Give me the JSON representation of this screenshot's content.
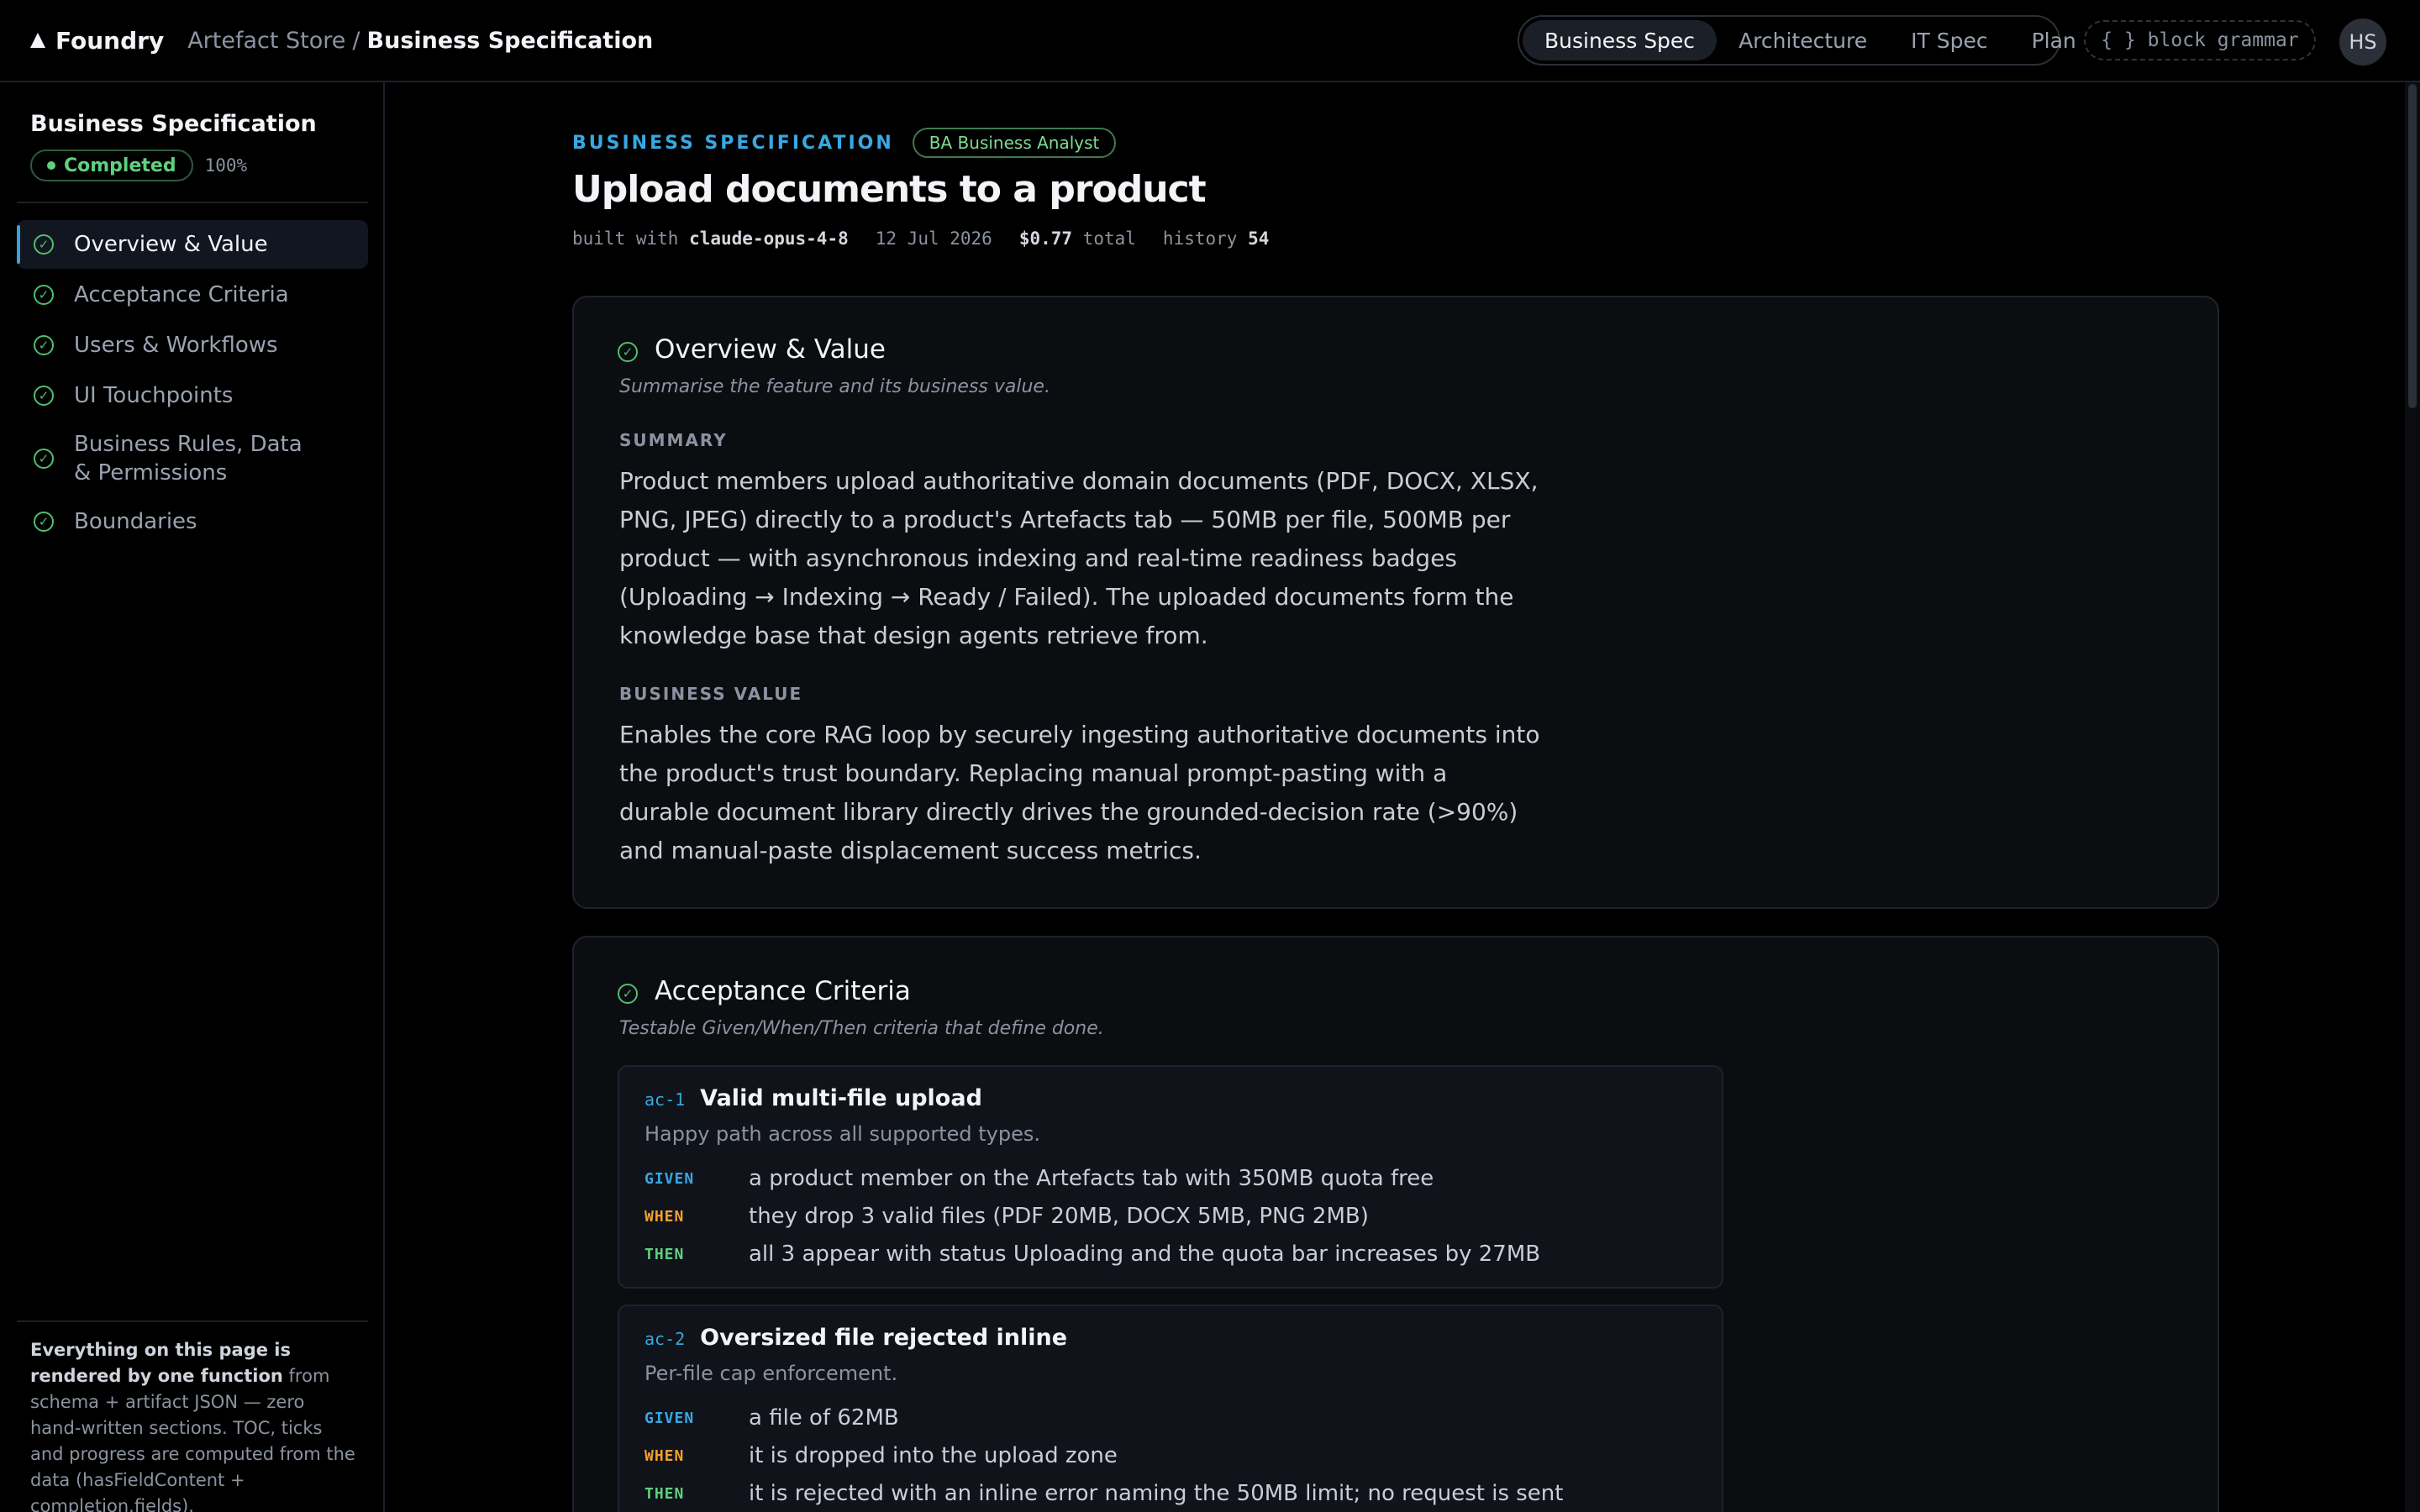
{
  "app": {
    "brand": "Foundry"
  },
  "breadcrumb": {
    "parent": "Artefact Store",
    "separator": "/",
    "current": "Business Specification"
  },
  "tabs": [
    {
      "label": "Business Spec",
      "active": true
    },
    {
      "label": "Architecture",
      "active": false
    },
    {
      "label": "IT Spec",
      "active": false
    },
    {
      "label": "Plan",
      "active": false
    }
  ],
  "header": {
    "grammar_label": "{ } block grammar",
    "avatar_initials": "HS"
  },
  "sidebar": {
    "title": "Business Specification",
    "status_label": "Completed",
    "progress": "100%",
    "items": [
      {
        "label": "Overview & Value",
        "active": true
      },
      {
        "label": "Acceptance Criteria",
        "active": false
      },
      {
        "label": "Users & Workflows",
        "active": false
      },
      {
        "label": "UI Touchpoints",
        "active": false
      },
      {
        "label": "Business Rules, Data & Permissions",
        "active": false
      },
      {
        "label": "Boundaries",
        "active": false
      }
    ],
    "footer_bold": "Everything on this page is rendered by one function",
    "footer_text": "from schema + artifact JSON — zero hand-written sections. TOC, ticks and progress are computed from the data (hasFieldContent + completion.fields)."
  },
  "page": {
    "eyebrow": "BUSINESS SPECIFICATION",
    "role_badge": "BA Business Analyst",
    "title": "Upload documents to a product",
    "meta": {
      "built_with_label": "built with",
      "model": "claude-opus-4-8",
      "date": "12 Jul 2026",
      "cost": "$0.77",
      "cost_suffix": "total",
      "history_label": "history",
      "history_count": "54"
    }
  },
  "overview": {
    "title": "Overview & Value",
    "subtitle": "Summarise the feature and its business value.",
    "summary_label": "SUMMARY",
    "summary": "Product members upload authoritative domain documents (PDF, DOCX, XLSX, PNG, JPEG) directly to a product's Artefacts tab — 50MB per file, 500MB per product — with asynchronous indexing and real-time readiness badges (Uploading → Indexing → Ready / Failed). The uploaded documents form the knowledge base that design agents retrieve from.",
    "value_label": "BUSINESS VALUE",
    "value": "Enables the core RAG loop by securely ingesting authoritative documents into the product's trust boundary. Replacing manual prompt-pasting with a durable document library directly drives the grounded-decision rate (>90%) and manual-paste displacement success metrics."
  },
  "acceptance": {
    "title": "Acceptance Criteria",
    "subtitle": "Testable Given/When/Then criteria that define done.",
    "keywords": {
      "given": "GIVEN",
      "when": "WHEN",
      "then": "THEN"
    },
    "criteria": [
      {
        "id": "ac-1",
        "title": "Valid multi-file upload",
        "subtitle": "Happy path across all supported types.",
        "given": "a product member on the Artefacts tab with 350MB quota free",
        "when": "they drop 3 valid files (PDF 20MB, DOCX 5MB, PNG 2MB)",
        "then": "all 3 appear with status Uploading and the quota bar increases by 27MB"
      },
      {
        "id": "ac-2",
        "title": "Oversized file rejected inline",
        "subtitle": "Per-file cap enforcement.",
        "given": "a file of 62MB",
        "when": "it is dropped into the upload zone",
        "then": "it is rejected with an inline error naming the 50MB limit; no request is sent"
      }
    ]
  }
}
